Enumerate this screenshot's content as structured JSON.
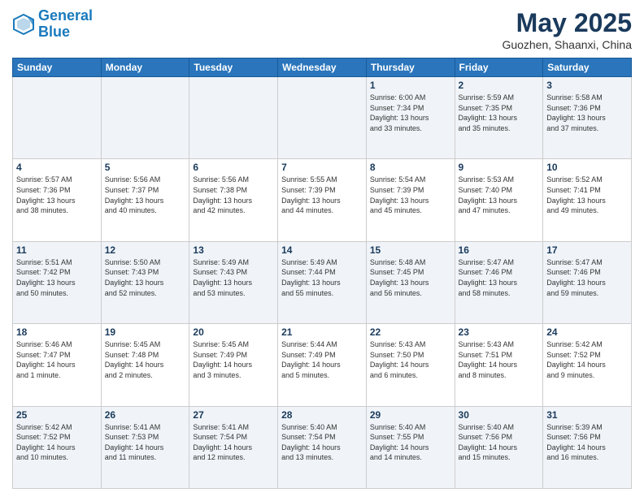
{
  "header": {
    "logo_line1": "General",
    "logo_line2": "Blue",
    "title": "May 2025",
    "subtitle": "Guozhen, Shaanxi, China"
  },
  "weekdays": [
    "Sunday",
    "Monday",
    "Tuesday",
    "Wednesday",
    "Thursday",
    "Friday",
    "Saturday"
  ],
  "weeks": [
    [
      {
        "day": "",
        "info": ""
      },
      {
        "day": "",
        "info": ""
      },
      {
        "day": "",
        "info": ""
      },
      {
        "day": "",
        "info": ""
      },
      {
        "day": "1",
        "info": "Sunrise: 6:00 AM\nSunset: 7:34 PM\nDaylight: 13 hours\nand 33 minutes."
      },
      {
        "day": "2",
        "info": "Sunrise: 5:59 AM\nSunset: 7:35 PM\nDaylight: 13 hours\nand 35 minutes."
      },
      {
        "day": "3",
        "info": "Sunrise: 5:58 AM\nSunset: 7:36 PM\nDaylight: 13 hours\nand 37 minutes."
      }
    ],
    [
      {
        "day": "4",
        "info": "Sunrise: 5:57 AM\nSunset: 7:36 PM\nDaylight: 13 hours\nand 38 minutes."
      },
      {
        "day": "5",
        "info": "Sunrise: 5:56 AM\nSunset: 7:37 PM\nDaylight: 13 hours\nand 40 minutes."
      },
      {
        "day": "6",
        "info": "Sunrise: 5:56 AM\nSunset: 7:38 PM\nDaylight: 13 hours\nand 42 minutes."
      },
      {
        "day": "7",
        "info": "Sunrise: 5:55 AM\nSunset: 7:39 PM\nDaylight: 13 hours\nand 44 minutes."
      },
      {
        "day": "8",
        "info": "Sunrise: 5:54 AM\nSunset: 7:39 PM\nDaylight: 13 hours\nand 45 minutes."
      },
      {
        "day": "9",
        "info": "Sunrise: 5:53 AM\nSunset: 7:40 PM\nDaylight: 13 hours\nand 47 minutes."
      },
      {
        "day": "10",
        "info": "Sunrise: 5:52 AM\nSunset: 7:41 PM\nDaylight: 13 hours\nand 49 minutes."
      }
    ],
    [
      {
        "day": "11",
        "info": "Sunrise: 5:51 AM\nSunset: 7:42 PM\nDaylight: 13 hours\nand 50 minutes."
      },
      {
        "day": "12",
        "info": "Sunrise: 5:50 AM\nSunset: 7:43 PM\nDaylight: 13 hours\nand 52 minutes."
      },
      {
        "day": "13",
        "info": "Sunrise: 5:49 AM\nSunset: 7:43 PM\nDaylight: 13 hours\nand 53 minutes."
      },
      {
        "day": "14",
        "info": "Sunrise: 5:49 AM\nSunset: 7:44 PM\nDaylight: 13 hours\nand 55 minutes."
      },
      {
        "day": "15",
        "info": "Sunrise: 5:48 AM\nSunset: 7:45 PM\nDaylight: 13 hours\nand 56 minutes."
      },
      {
        "day": "16",
        "info": "Sunrise: 5:47 AM\nSunset: 7:46 PM\nDaylight: 13 hours\nand 58 minutes."
      },
      {
        "day": "17",
        "info": "Sunrise: 5:47 AM\nSunset: 7:46 PM\nDaylight: 13 hours\nand 59 minutes."
      }
    ],
    [
      {
        "day": "18",
        "info": "Sunrise: 5:46 AM\nSunset: 7:47 PM\nDaylight: 14 hours\nand 1 minute."
      },
      {
        "day": "19",
        "info": "Sunrise: 5:45 AM\nSunset: 7:48 PM\nDaylight: 14 hours\nand 2 minutes."
      },
      {
        "day": "20",
        "info": "Sunrise: 5:45 AM\nSunset: 7:49 PM\nDaylight: 14 hours\nand 3 minutes."
      },
      {
        "day": "21",
        "info": "Sunrise: 5:44 AM\nSunset: 7:49 PM\nDaylight: 14 hours\nand 5 minutes."
      },
      {
        "day": "22",
        "info": "Sunrise: 5:43 AM\nSunset: 7:50 PM\nDaylight: 14 hours\nand 6 minutes."
      },
      {
        "day": "23",
        "info": "Sunrise: 5:43 AM\nSunset: 7:51 PM\nDaylight: 14 hours\nand 8 minutes."
      },
      {
        "day": "24",
        "info": "Sunrise: 5:42 AM\nSunset: 7:52 PM\nDaylight: 14 hours\nand 9 minutes."
      }
    ],
    [
      {
        "day": "25",
        "info": "Sunrise: 5:42 AM\nSunset: 7:52 PM\nDaylight: 14 hours\nand 10 minutes."
      },
      {
        "day": "26",
        "info": "Sunrise: 5:41 AM\nSunset: 7:53 PM\nDaylight: 14 hours\nand 11 minutes."
      },
      {
        "day": "27",
        "info": "Sunrise: 5:41 AM\nSunset: 7:54 PM\nDaylight: 14 hours\nand 12 minutes."
      },
      {
        "day": "28",
        "info": "Sunrise: 5:40 AM\nSunset: 7:54 PM\nDaylight: 14 hours\nand 13 minutes."
      },
      {
        "day": "29",
        "info": "Sunrise: 5:40 AM\nSunset: 7:55 PM\nDaylight: 14 hours\nand 14 minutes."
      },
      {
        "day": "30",
        "info": "Sunrise: 5:40 AM\nSunset: 7:56 PM\nDaylight: 14 hours\nand 15 minutes."
      },
      {
        "day": "31",
        "info": "Sunrise: 5:39 AM\nSunset: 7:56 PM\nDaylight: 14 hours\nand 16 minutes."
      }
    ]
  ]
}
